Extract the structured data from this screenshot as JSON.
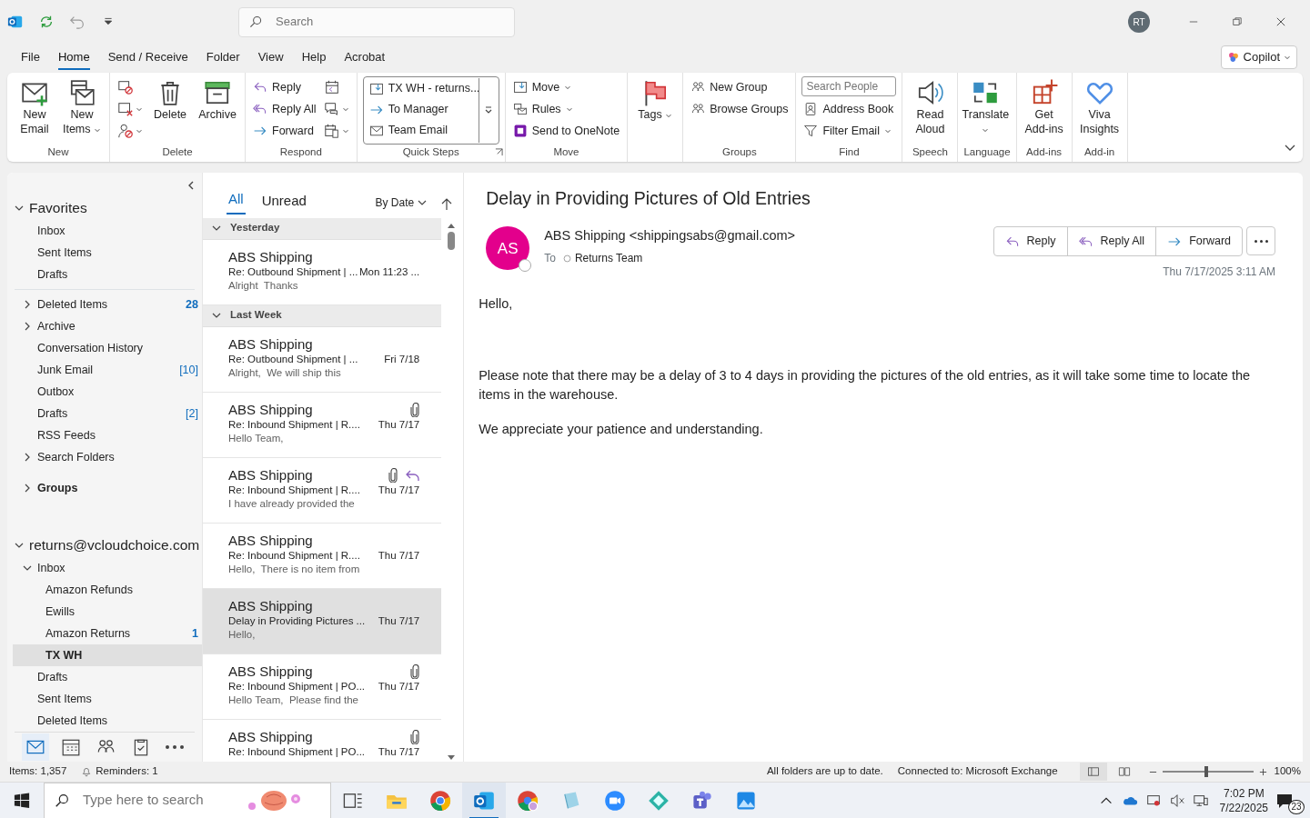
{
  "title_bar": {
    "search_placeholder": "Search",
    "avatar": "RT"
  },
  "menu_tabs": [
    {
      "label": "File",
      "selected": false
    },
    {
      "label": "Home",
      "selected": true
    },
    {
      "label": "Send / Receive",
      "selected": false
    },
    {
      "label": "Folder",
      "selected": false
    },
    {
      "label": "View",
      "selected": false
    },
    {
      "label": "Help",
      "selected": false
    },
    {
      "label": "Acrobat",
      "selected": false
    }
  ],
  "copilot": {
    "label": "Copilot"
  },
  "ribbon": [
    {
      "label": "New",
      "columns": [
        [
          {
            "kind": "large",
            "label": "New Email"
          }
        ],
        [
          {
            "kind": "large",
            "label": "New Items",
            "dropdown": true
          }
        ]
      ]
    },
    {
      "label": "Delete",
      "columns": [
        [
          {
            "kind": "icon"
          },
          {
            "kind": "icon",
            "dropdown": true
          },
          {
            "kind": "icon",
            "dropdown": true
          }
        ],
        [
          {
            "kind": "large",
            "label": "Delete"
          }
        ],
        [
          {
            "kind": "large",
            "label": "Archive"
          }
        ]
      ]
    },
    {
      "label": "Respond",
      "columns": [
        [
          {
            "kind": "small",
            "label": "Reply"
          },
          {
            "kind": "small",
            "label": "Reply All"
          },
          {
            "kind": "small",
            "label": "Forward"
          }
        ],
        [
          {
            "kind": "icon"
          },
          {
            "kind": "icon",
            "dropdown": true
          },
          {
            "kind": "icon",
            "dropdown": true
          }
        ]
      ]
    },
    {
      "label": "Quick Steps",
      "launcher": true,
      "columns": [
        [
          {
            "kind": "gallery",
            "label": "TX WH - returns..."
          },
          {
            "kind": "gallery",
            "label": "To Manager"
          },
          {
            "kind": "gallery",
            "label": "Team Email"
          }
        ]
      ]
    },
    {
      "label": "Move",
      "columns": [
        [
          {
            "kind": "small",
            "label": "Move",
            "dropdown": true
          },
          {
            "kind": "small",
            "label": "Rules",
            "dropdown": true
          },
          {
            "kind": "small",
            "label": "Send to OneNote"
          }
        ]
      ]
    },
    {
      "columns": [
        [
          {
            "kind": "large",
            "label": "Tags",
            "dropdown": true
          }
        ]
      ]
    },
    {
      "label": "Groups",
      "columns": [
        [
          {
            "kind": "small",
            "label": "New Group"
          },
          {
            "kind": "small",
            "label": "Browse Groups"
          }
        ]
      ]
    },
    {
      "label": "Find",
      "columns": [
        [
          {
            "kind": "field",
            "placeholder": "Search People"
          },
          {
            "kind": "small",
            "label": "Address Book"
          },
          {
            "kind": "small",
            "label": "Filter Email",
            "dropdown": true
          }
        ]
      ]
    },
    {
      "label": "Speech",
      "columns": [
        [
          {
            "kind": "large",
            "label": "Read Aloud"
          }
        ]
      ]
    },
    {
      "label": "Language",
      "columns": [
        [
          {
            "kind": "large",
            "label": "Translate",
            "dropdown": true
          }
        ]
      ]
    },
    {
      "label": "Add-ins",
      "columns": [
        [
          {
            "kind": "large",
            "label": "Get Add-ins"
          }
        ]
      ]
    },
    {
      "label": "Add-in",
      "columns": [
        [
          {
            "kind": "large",
            "label": "Viva Insights"
          }
        ]
      ]
    }
  ],
  "folder_pane": {
    "favorites": {
      "label": "Favorites",
      "expanded": true,
      "selected": false,
      "children": [
        {
          "label": "Inbox",
          "selected": false
        },
        {
          "label": "Sent Items",
          "selected": false
        },
        {
          "label": "Drafts",
          "selected": false
        }
      ]
    },
    "folders": [
      {
        "label": "Deleted Items",
        "expanded": false,
        "count": "28",
        "unread": true,
        "selected": false
      },
      {
        "label": "Archive",
        "expanded": false,
        "selected": false
      },
      {
        "label": "Conversation History",
        "selected": false
      },
      {
        "label": "Junk Email",
        "count": "[10]",
        "unread": false,
        "selected": false
      },
      {
        "label": "Outbox",
        "selected": false
      },
      {
        "label": "Drafts",
        "count": "[2]",
        "unread": false,
        "selected": false
      },
      {
        "label": "RSS Feeds",
        "selected": false
      },
      {
        "label": "Search Folders",
        "expanded": false,
        "selected": false
      },
      {
        "label": "Groups",
        "kind": "group",
        "expanded": false,
        "selected": false
      }
    ],
    "account": {
      "label": "returns@vcloudchoice.com",
      "expanded": true,
      "selected": false,
      "children": [
        {
          "label": "Inbox",
          "expanded": true,
          "selected": false,
          "children": [
            {
              "label": "Amazon Refunds",
              "selected": false
            },
            {
              "label": "Ewills",
              "selected": false
            },
            {
              "label": "Amazon Returns",
              "count": "1",
              "unread": true,
              "selected": false
            },
            {
              "label": "TX WH",
              "selected": true
            }
          ]
        },
        {
          "label": "Drafts",
          "selected": false
        },
        {
          "label": "Sent Items",
          "selected": false
        },
        {
          "label": "Deleted Items",
          "selected": false
        }
      ]
    },
    "nav": [
      {
        "selected": true
      },
      {
        "selected": false
      },
      {
        "selected": false
      },
      {
        "selected": false
      },
      {
        "selected": false
      }
    ]
  },
  "message_list": {
    "filters": [
      {
        "label": "All",
        "selected": true
      },
      {
        "label": "Unread",
        "selected": false
      }
    ],
    "sort": "By Date",
    "groups": [
      {
        "label": "Yesterday",
        "expanded": true,
        "messages": [
          {
            "sender": "ABS Shipping",
            "subject": "Re: Outbound Shipment | ...",
            "date": "Mon 11:23 ...",
            "preview": "Alright  Thanks",
            "attachment": false,
            "replied": false,
            "selected": false
          }
        ]
      },
      {
        "label": "Last Week",
        "expanded": true,
        "messages": [
          {
            "sender": "ABS Shipping",
            "subject": "Re: Outbound Shipment | ...",
            "date": "Fri 7/18",
            "preview": "Alright,  We will ship this",
            "attachment": false,
            "replied": false,
            "selected": false
          },
          {
            "sender": "ABS Shipping",
            "subject": "Re: Inbound Shipment | R....",
            "date": "Thu 7/17",
            "preview": "Hello Team,",
            "attachment": true,
            "replied": false,
            "selected": false
          },
          {
            "sender": "ABS Shipping",
            "subject": "Re: Inbound Shipment | R....",
            "date": "Thu 7/17",
            "preview": "I have already provided the",
            "attachment": true,
            "replied": true,
            "selected": false
          },
          {
            "sender": "ABS Shipping",
            "subject": "Re: Inbound Shipment | R....",
            "date": "Thu 7/17",
            "preview": "Hello,  There is no item from",
            "attachment": false,
            "replied": false,
            "selected": false
          },
          {
            "sender": "ABS Shipping",
            "subject": "Delay in Providing Pictures ...",
            "date": "Thu 7/17",
            "preview": "Hello,",
            "attachment": false,
            "replied": false,
            "selected": true
          },
          {
            "sender": "ABS Shipping",
            "subject": "Re: Inbound Shipment | PO...",
            "date": "Thu 7/17",
            "preview": "Hello Team,  Please find the",
            "attachment": true,
            "replied": false,
            "selected": false
          },
          {
            "sender": "ABS Shipping",
            "subject": "Re: Inbound Shipment | PO...",
            "date": "Thu 7/17",
            "attachment": true,
            "replied": false,
            "selected": false
          }
        ]
      }
    ]
  },
  "reading_pane": {
    "subject": "Delay in Providing Pictures of Old Entries",
    "avatar": "AS",
    "from": "ABS Shipping <shippingsabs@gmail.com>",
    "to_label": "To",
    "to": "Returns Team",
    "actions": [
      "Reply",
      "Reply All",
      "Forward"
    ],
    "date": "Thu 7/17/2025 3:11 AM",
    "body": [
      "Hello,",
      "Please note that there may be a delay of 3 to 4 days in providing the pictures of the old entries, as it will take some time to locate the items in the warehouse.",
      "We appreciate your patience and understanding."
    ]
  },
  "status_bar": {
    "items": "Items: 1,357",
    "reminders": "Reminders: 1",
    "sync": "All folders are up to date.",
    "connection": "Connected to: Microsoft Exchange",
    "views": [
      {
        "selected": true
      },
      {
        "selected": false
      }
    ],
    "level": 0.48,
    "zoom": "100%"
  },
  "taskbar": {
    "search_placeholder": "Type here to search",
    "apps": [
      {
        "active": false
      },
      {
        "active": false
      },
      {
        "active": false
      },
      {
        "active": true
      },
      {
        "active": false
      },
      {
        "active": false
      },
      {
        "active": false
      },
      {
        "active": false
      },
      {
        "active": false
      },
      {
        "active": false
      }
    ],
    "time": "7:02 PM",
    "date": "7/22/2025",
    "notifications": "23"
  }
}
